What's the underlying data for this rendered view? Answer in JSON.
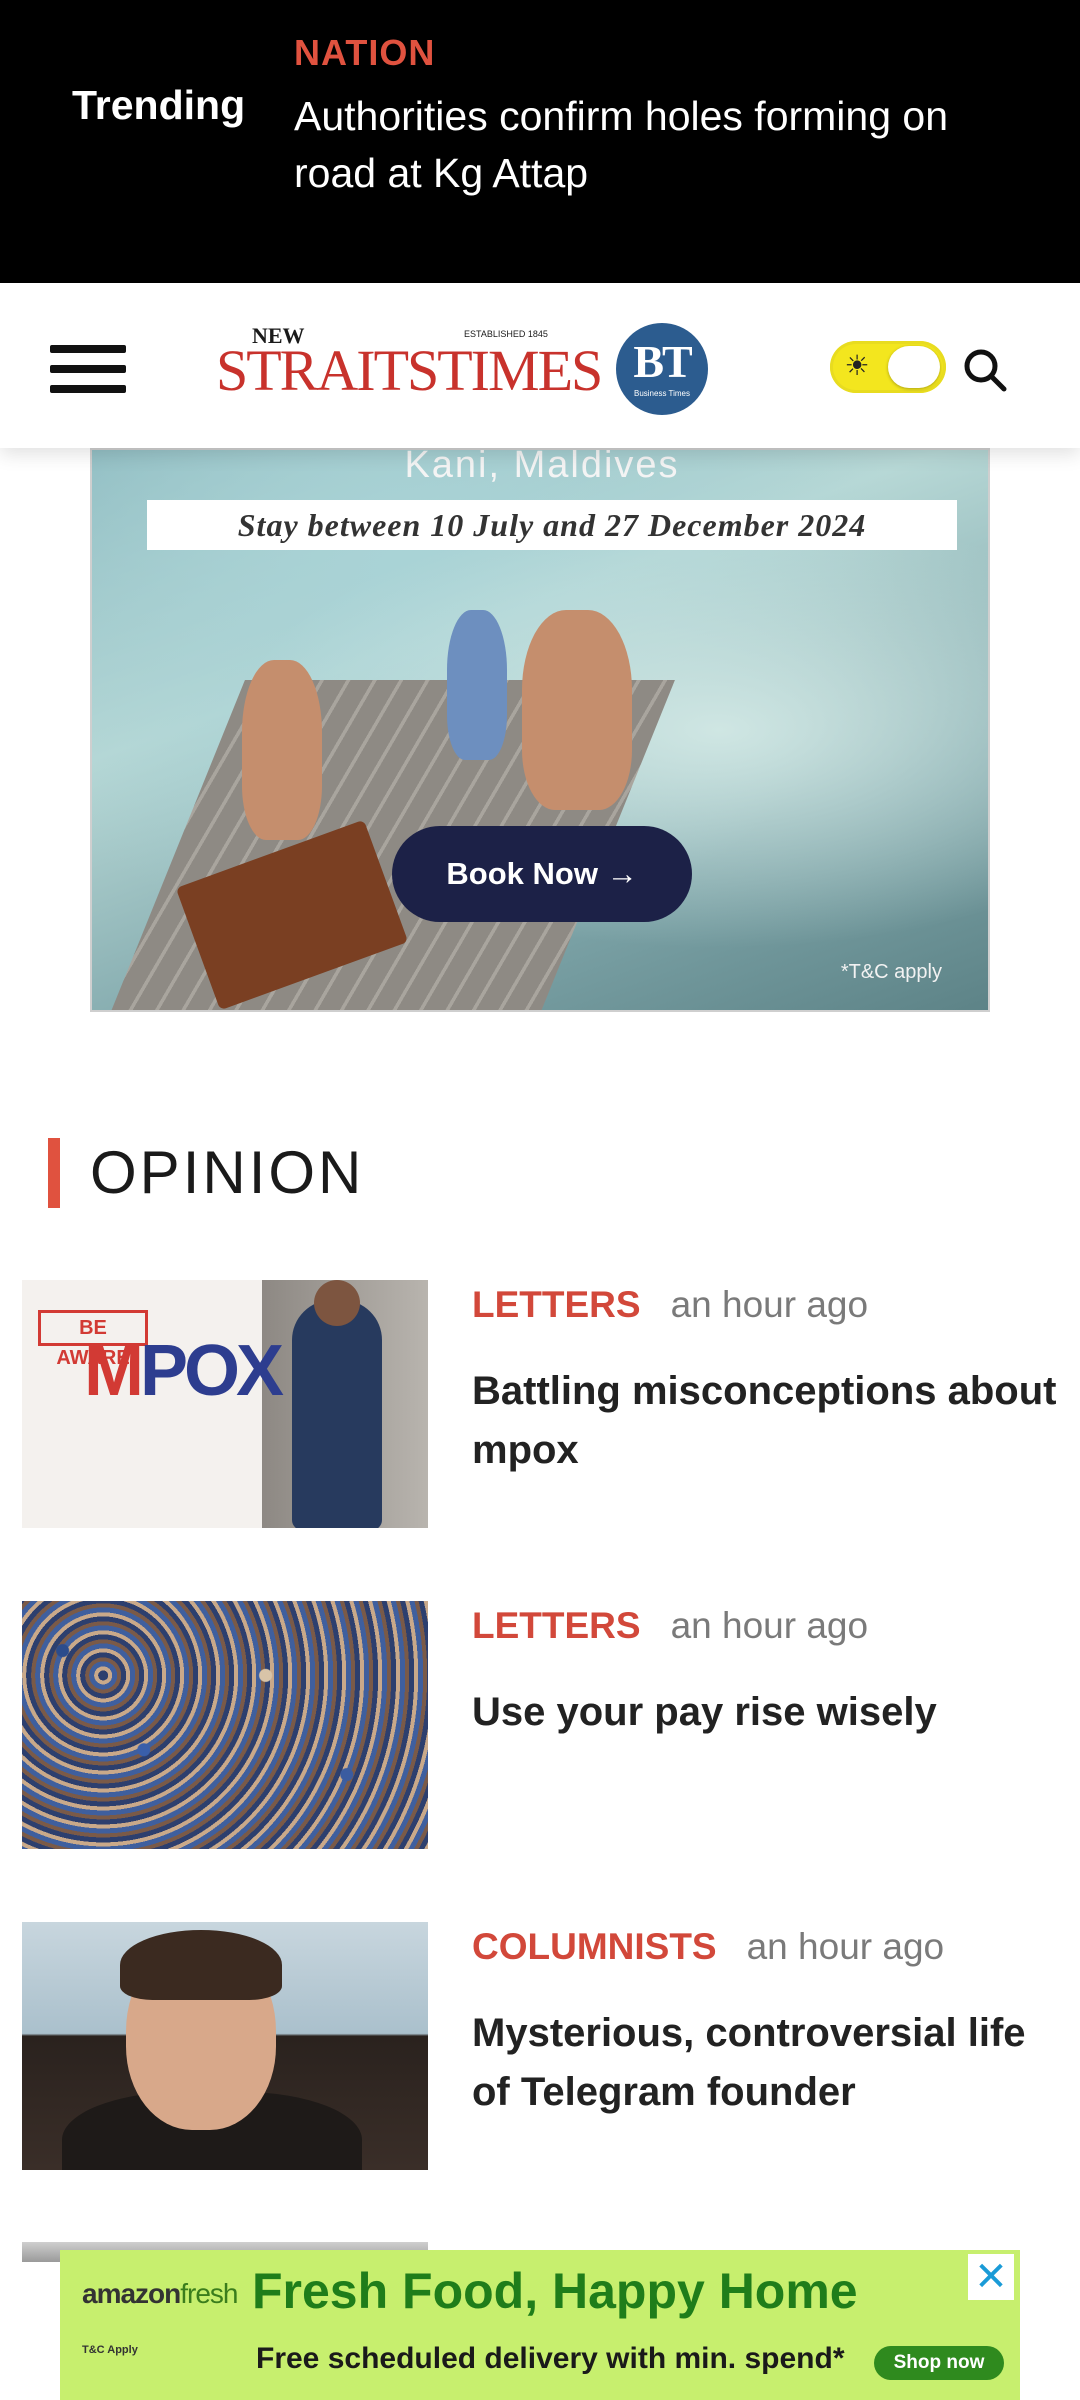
{
  "trending": {
    "label": "Trending",
    "category": "NATION",
    "headline": "Authorities confirm holes forming on road at Kg Attap"
  },
  "header": {
    "logo_new": "NEW",
    "logo_established": "ESTABLISHED 1845",
    "logo_main": "STRAITSTIMES",
    "bt_letters": "BT",
    "bt_sub": "Business Times",
    "theme_toggle_state": "light",
    "icons": [
      "hamburger-menu-icon",
      "sun-icon",
      "search-icon"
    ]
  },
  "ad_banner": {
    "location": "Kani, Maldives",
    "dates": "Stay between 10 July and 27 December 2024",
    "cta": "Book Now →",
    "terms": "*T&C apply"
  },
  "section": {
    "title": "OPINION",
    "accent_color": "#e0523f"
  },
  "articles": [
    {
      "category": "LETTERS",
      "time": "an hour ago",
      "headline": "Battling misconceptions about mpox",
      "thumb_text": {
        "aware": "BE AWARE",
        "m": "M",
        "pox": "POX"
      }
    },
    {
      "category": "LETTERS",
      "time": "an hour ago",
      "headline": "Use your pay rise wisely"
    },
    {
      "category": "COLUMNISTS",
      "time": "an hour ago",
      "headline": "Mysterious, controversial life of Telegram founder"
    }
  ],
  "bottom_ad": {
    "brand_a": "amazon",
    "brand_b": "fresh",
    "title": "Fresh Food, Happy Home",
    "note": "T&C Apply",
    "subtitle": "Free scheduled delivery with min. spend*",
    "cta": "Shop now",
    "close": "✕"
  }
}
